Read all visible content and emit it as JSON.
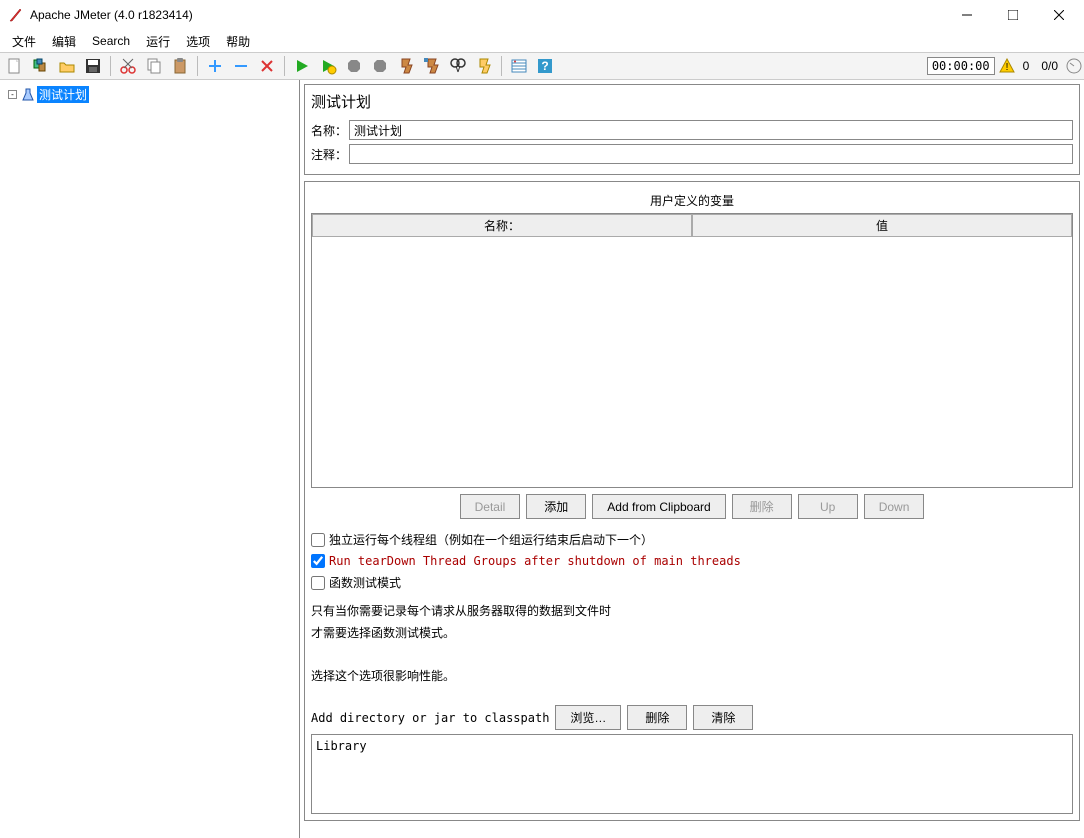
{
  "window": {
    "title": "Apache JMeter (4.0 r1823414)"
  },
  "menu": {
    "items": [
      "文件",
      "编辑",
      "Search",
      "运行",
      "选项",
      "帮助"
    ]
  },
  "toolbar": {
    "timer": "00:00:00",
    "error_count": "0",
    "thread_count": "0/0"
  },
  "tree": {
    "root": "测试计划"
  },
  "panel": {
    "title": "测试计划",
    "name_label": "名称：",
    "name_value": "测试计划",
    "comment_label": "注释：",
    "comment_value": "",
    "vars_caption": "用户定义的变量",
    "vars_col_name": "名称：",
    "vars_col_value": "值",
    "buttons": {
      "detail": "Detail",
      "add": "添加",
      "add_clipboard": "Add from Clipboard",
      "delete": "删除",
      "up": "Up",
      "down": "Down"
    },
    "check_serial": "独立运行每个线程组（例如在一个组运行结束后启动下一个）",
    "check_teardown": "Run tearDown Thread Groups after shutdown of main threads",
    "check_functional": "函数测试模式",
    "info1": "只有当你需要记录每个请求从服务器取得的数据到文件时",
    "info2": "才需要选择函数测试模式。",
    "info3": "选择这个选项很影响性能。",
    "classpath_label": "Add directory or jar to classpath",
    "classpath_browse": "浏览…",
    "classpath_delete": "删除",
    "classpath_clear": "清除",
    "library_header": "Library"
  }
}
